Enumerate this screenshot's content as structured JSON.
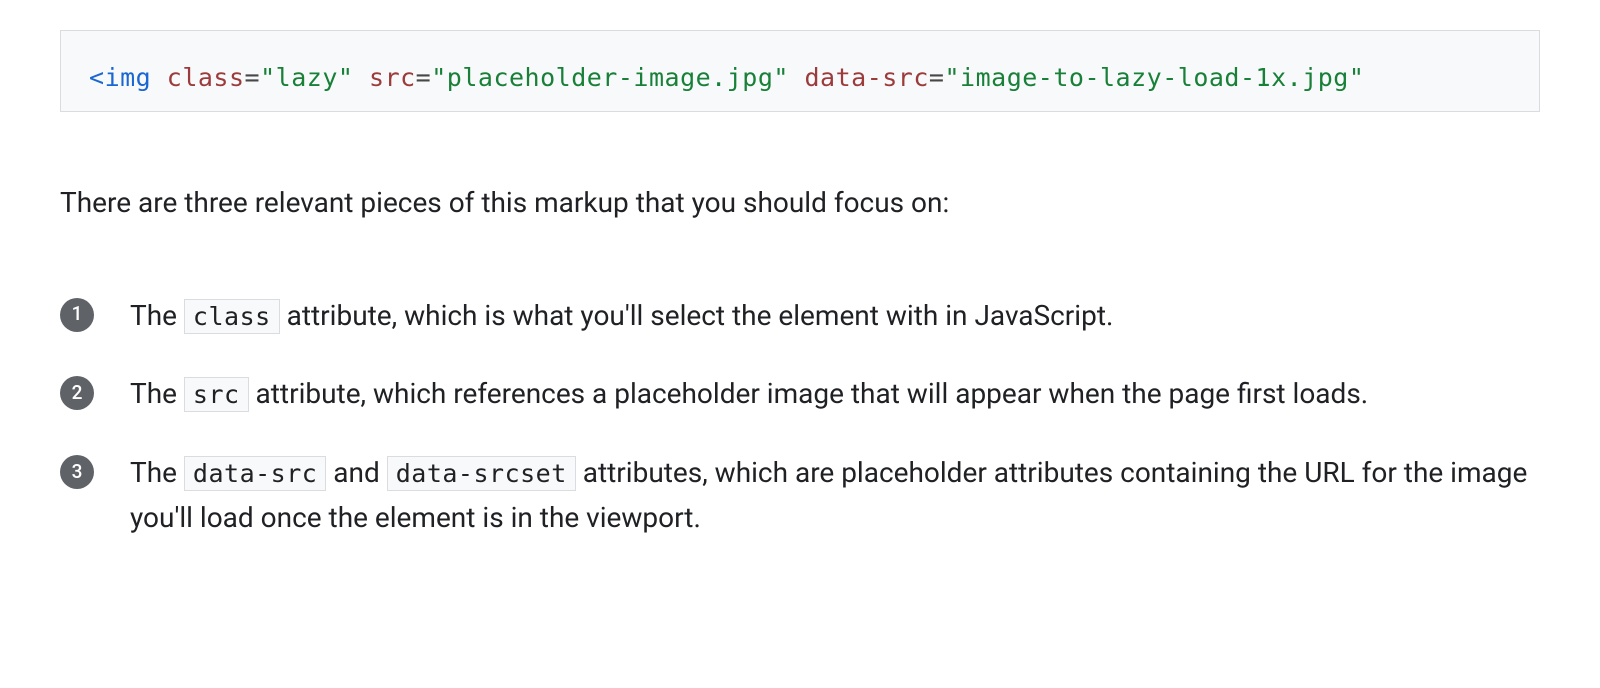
{
  "code": {
    "open_bracket": "<",
    "tag": "img",
    "attr_class": "class",
    "eq": "=",
    "q": "\"",
    "val_class": "lazy",
    "attr_src": "src",
    "val_src": "placeholder-image.jpg",
    "attr_data_src": "data-src",
    "val_data_src": "image-to-lazy-load-1x.jpg"
  },
  "intro": "There are three relevant pieces of this markup that you should focus on:",
  "list": {
    "item1": {
      "pre": "The ",
      "code1": "class",
      "post": " attribute, which is what you'll select the element with in JavaScript."
    },
    "item2": {
      "pre": "The ",
      "code1": "src",
      "post": " attribute, which references a placeholder image that will appear when the page first loads."
    },
    "item3": {
      "pre": "The ",
      "code1": "data-src",
      "mid": " and ",
      "code2": "data-srcset",
      "post": " attributes, which are placeholder attributes containing the URL for the image you'll load once the element is in the viewport."
    }
  }
}
